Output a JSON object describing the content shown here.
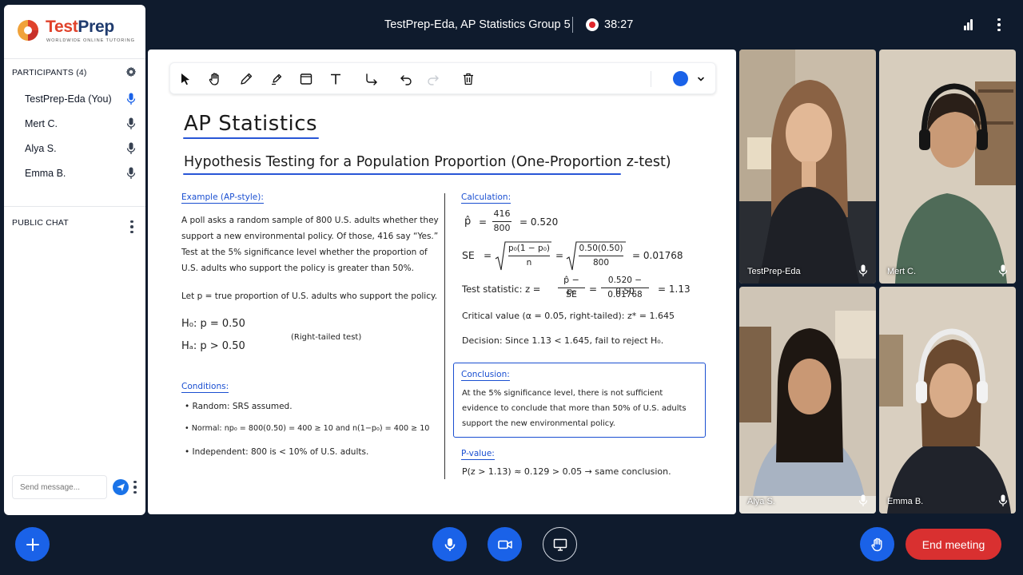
{
  "header": {
    "meeting_title": "TestPrep-Eda, AP Statistics Group 5",
    "timer": "38:27"
  },
  "sidebar": {
    "logo": {
      "brand_test": "Test",
      "brand_prep": "Prep",
      "tagline": "WORLDWIDE ONLINE TUTORING"
    },
    "participants_title": "PARTICIPANTS (4)",
    "participants": [
      {
        "name": "TestPrep-Eda (You)",
        "mic": "active"
      },
      {
        "name": "Mert C.",
        "mic": "on"
      },
      {
        "name": "Alya S.",
        "mic": "on"
      },
      {
        "name": "Emma B.",
        "mic": "on"
      }
    ],
    "chat_title": "PUBLIC CHAT",
    "chat_placeholder": "Send message..."
  },
  "whiteboard": {
    "toolbar": {
      "tools": [
        "select-icon",
        "hand-icon",
        "pencil-icon",
        "highlighter-icon",
        "rectangle-icon",
        "text-icon",
        "connector-icon",
        "undo-icon",
        "redo-icon",
        "trash-icon"
      ],
      "active_color": "#1a62e8"
    },
    "title": "AP Statistics",
    "subtitle": "Hypothesis Testing for a Population Proportion (One-Proportion z-test)",
    "example": {
      "heading": "Example (AP-style):",
      "lines": [
        "A poll asks a random sample of 800 U.S. adults whether they",
        "support a new environmental policy. Of those, 416 say “Yes.”",
        "Test at the 5% significance level whether the proportion of",
        "U.S. adults who support the policy is greater than 50%."
      ],
      "let_p": "Let p = true proportion of U.S. adults who support the policy.",
      "h0": "H₀: p = 0.50",
      "ha": "Hₐ: p > 0.50",
      "tail_note": "(Right-tailed test)"
    },
    "conditions": {
      "heading": "Conditions:",
      "items": [
        "• Random: SRS assumed.",
        "• Normal: np₀ = 800(0.50) = 400 ≥ 10 and n(1−p₀) = 400 ≥ 10",
        "• Independent: 800 is < 10% of U.S. adults."
      ]
    },
    "calculation": {
      "heading": "Calculation:",
      "phat_label": "p̂",
      "phat_num": "416",
      "phat_den": "800",
      "phat_val": "= 0.520",
      "se_label": "SE",
      "se_num1": "p₀(1 − p₀)",
      "se_den1": "n",
      "se_num2": "0.50(0.50)",
      "se_den2": "800",
      "se_val": "= 0.01768",
      "z_label": "Test statistic: z =",
      "z_num1": "p̂ − p₀",
      "z_den1": "SE",
      "z_num2": "0.520 − 0.50",
      "z_den2": "0.01768",
      "z_val": "= 1.13",
      "critical": "Critical value (α = 0.05, right-tailed): z* = 1.645",
      "decision": "Decision: Since 1.13 < 1.645, fail to reject H₀."
    },
    "conclusion": {
      "heading": "Conclusion:",
      "lines": [
        "At the 5% significance level, there is not sufficient",
        "evidence to conclude that more than 50% of U.S. adults",
        "support the new environmental policy."
      ]
    },
    "pvalue": {
      "heading": "P-value:",
      "text": "P(z > 1.13) ≈ 0.129 > 0.05 → same conclusion."
    }
  },
  "videos": [
    {
      "name": "TestPrep-Eda"
    },
    {
      "name": "Mert C."
    },
    {
      "name": "Alya S."
    },
    {
      "name": "Emma B."
    }
  ],
  "controls": {
    "end_label": "End meeting",
    "colors": {
      "primary": "#1a62e8",
      "end": "#d93030",
      "background": "#0f1b2d"
    }
  }
}
